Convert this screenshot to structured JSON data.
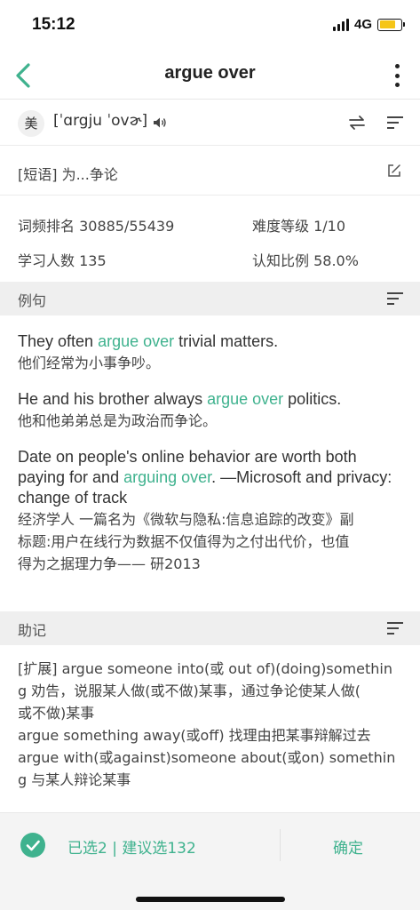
{
  "status": {
    "time": "15:12",
    "network": "4G",
    "battery_level": 0.75
  },
  "nav": {
    "title": "argue over",
    "back_icon": "chevron-left-icon",
    "more_icon": "more-vertical-icon"
  },
  "phonetic": {
    "accent": "美",
    "ipa": "[ˈɑrgju ˈovɚ]"
  },
  "definition": "[短语] 为...争论",
  "stats": {
    "freq_rank": "词频排名 30885/55439",
    "difficulty": "难度等级 1/10",
    "learners": "学习人数 135",
    "cognition": "认知比例 58.0%"
  },
  "examples_section": {
    "title": "例句"
  },
  "examples": [
    {
      "en_before": "They often ",
      "en_hl": "argue over",
      "en_after": " trivial matters.",
      "zh": "他们经常为小事争吵。"
    },
    {
      "en_before": "He and his brother always ",
      "en_hl": "argue over",
      "en_after": " politics.",
      "zh": "他和他弟弟总是为政治而争论。"
    },
    {
      "en_before": "Date on people's online behavior are worth both paying for and ",
      "en_hl": "arguing over",
      "en_after": ". —Microsoft and privacy: change of track",
      "zh_lines": [
        "经济学人 一篇名为《微软与隐私:信息追踪的改变》副",
        "标题:用户在线行为数据不仅值得为之付出代价，也值",
        "得为之据理力争—— 研2013"
      ]
    }
  ],
  "mnemonic_section": {
    "title": "助记"
  },
  "mnemonic_lines": [
    "[扩展] argue someone into(或 out of)(doing)somethin",
    "g 劝告，说服某人做(或不做)某事，通过争论使某人做(",
    "或不做)某事",
    "argue something away(或off) 找理由把某事辩解过去",
    "argue with(或against)someone about(或on) somethin",
    "g 与某人辩论某事"
  ],
  "footer": {
    "selected": "已选2 | 建议选132",
    "confirm": "确定"
  },
  "colors": {
    "accent": "#3fb28e"
  }
}
